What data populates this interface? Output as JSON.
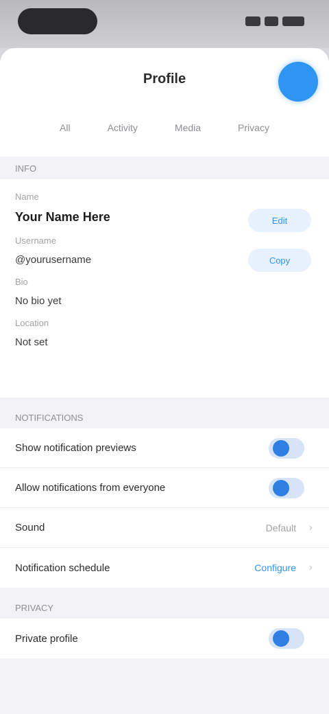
{
  "header": {
    "title": "Profile",
    "tabs": [
      "All",
      "Activity",
      "Media",
      "Privacy"
    ]
  },
  "sections": {
    "info_label": "INFO",
    "info": {
      "name_label": "Name",
      "name_value": "Your Name Here",
      "name_button": "Edit",
      "handle_label": "Username",
      "handle_value": "@yourusername",
      "handle_button": "Copy",
      "bio_label": "Bio",
      "bio_value": "No bio yet",
      "location_label": "Location",
      "location_value": "Not set"
    },
    "notifications_label": "NOTIFICATIONS",
    "notifications": [
      {
        "label": "Show notification previews",
        "type": "toggle",
        "on": true
      },
      {
        "label": "Allow notifications from everyone",
        "type": "toggle",
        "on": true
      },
      {
        "label": "Sound",
        "type": "value",
        "value": "Default"
      },
      {
        "label": "Notification schedule",
        "type": "link",
        "value": "Configure"
      }
    ],
    "privacy_label": "PRIVACY",
    "privacy": [
      {
        "label": "Private profile",
        "type": "toggle",
        "on": true
      }
    ]
  },
  "colors": {
    "accent": "#2f95f3",
    "background": "#f2f2f7"
  }
}
